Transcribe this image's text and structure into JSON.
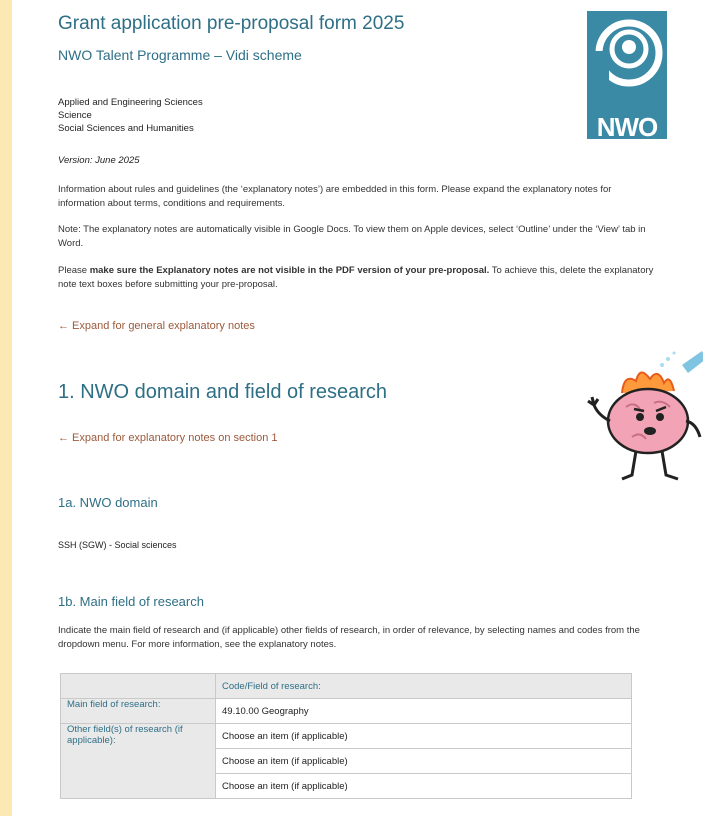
{
  "document": {
    "title": "Grant application pre-proposal form 2025",
    "subtitle": "NWO Talent Programme – Vidi scheme",
    "domains": [
      "Applied and Engineering Sciences",
      "Science",
      "Social Sciences and Humanities"
    ],
    "version": "Version: June 2025",
    "info_paragraph": "Information about rules and guidelines (the ‘explanatory notes’) are embedded in this form. Please expand the explanatory notes for information about terms, conditions and requirements.",
    "note_paragraph": "Note: The explanatory notes are automatically visible in Google Docs. To view them on Apple devices, select ‘Outline’ under the ‘View’ tab in Word.",
    "pdf_paragraph": {
      "prefix": "Please ",
      "bold": "make sure the Explanatory notes are not visible in the PDF version of your pre-proposal.",
      "suffix": " To achieve this, delete the explanatory note text boxes before submitting your pre-proposal."
    },
    "general_expander": "← Expand for general explanatory notes"
  },
  "logo": {
    "text": "NWO"
  },
  "section1": {
    "heading": "1.  NWO domain and field of research",
    "expander": "← Expand for explanatory notes on section 1",
    "sub_a": {
      "heading": "1a.  NWO domain",
      "value": "SSH (SGW) - Social sciences"
    },
    "sub_b": {
      "heading": "1b. Main field of research",
      "paragraph": "Indicate the main field of research and (if applicable) other fields of research, in order of relevance, by selecting names and codes from the dropdown menu. For more information, see the explanatory notes."
    }
  },
  "fields_table": {
    "header": "Code/Field of research:",
    "main_label": "Main field of research:",
    "main_value": "49.10.00   Geography",
    "other_label": "Other field(s) of research (if applicable):",
    "other_values": [
      "Choose an item (if applicable)",
      "Choose an item (if applicable)",
      "Choose an item (if applicable)"
    ]
  },
  "colors": {
    "heading": "#2e6f86",
    "expander": "#9c5a3c",
    "background": "#fce8b3",
    "logo": "#3a8aa6",
    "brain": "#f2a3b5"
  }
}
